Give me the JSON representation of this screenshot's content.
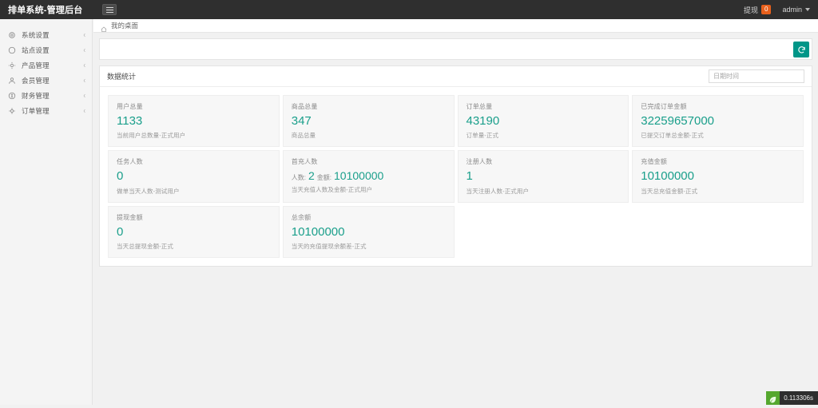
{
  "header": {
    "title": "排单系统-管理后台",
    "menu_toggle_icon": "hamburger-icon",
    "withdraw_label": "提现",
    "withdraw_count": "0",
    "admin_label": "admin"
  },
  "sidebar": {
    "items": [
      {
        "label": "系统设置",
        "icon": "gear-icon",
        "arrow": "‹"
      },
      {
        "label": "站点设置",
        "icon": "globe-icon",
        "arrow": "‹"
      },
      {
        "label": "产品管理",
        "icon": "cube-icon",
        "arrow": "‹"
      },
      {
        "label": "会员管理",
        "icon": "user-icon",
        "arrow": "‹"
      },
      {
        "label": "财务管理",
        "icon": "money-icon",
        "arrow": "‹"
      },
      {
        "label": "订单管理",
        "icon": "cart-icon",
        "arrow": "‹"
      }
    ]
  },
  "breadcrumb": {
    "home_icon": "home-icon",
    "current": "我的桌面"
  },
  "toolbar": {
    "refresh_icon": "refresh-icon"
  },
  "panel": {
    "title": "数据统计",
    "date_placeholder": "日期时间",
    "date_value": ""
  },
  "stats": [
    {
      "label": "用户总量",
      "value": "1133",
      "desc": "当前用户总数量-正式用户",
      "compound": false
    },
    {
      "label": "商品总量",
      "value": "347",
      "desc": "商品总量",
      "compound": false
    },
    {
      "label": "订单总量",
      "value": "43190",
      "desc": "订单量-正式",
      "compound": false
    },
    {
      "label": "已完成订单金额",
      "value": "32259657000",
      "desc": "已提交订单总金额-正式",
      "compound": false
    },
    {
      "label": "任务人数",
      "value": "0",
      "desc": "做单当天人数-测试用户",
      "compound": false
    },
    {
      "label": "首充人数",
      "value": "",
      "desc": "当天充值人数及金额-正式用户",
      "compound": true,
      "people_prefix": "人数:",
      "people_value": "2",
      "amount_prefix": "金额:",
      "amount_value": "10100000"
    },
    {
      "label": "注册人数",
      "value": "1",
      "desc": "当天注册人数-正式用户",
      "compound": false
    },
    {
      "label": "充值金额",
      "value": "10100000",
      "desc": "当天总充值金额-正式",
      "compound": false
    },
    {
      "label": "提现金额",
      "value": "0",
      "desc": "当天总提现金额-正式",
      "compound": false
    },
    {
      "label": "总余额",
      "value": "10100000",
      "desc": "当天的充值提现余额差-正式",
      "compound": false
    }
  ],
  "footer": {
    "leaf_icon": "leaf-icon",
    "elapsed": "0.113306s"
  },
  "colors": {
    "accent": "#009688",
    "value_text": "#1a9f8b",
    "badge": "#e8601c",
    "topbar": "#2f2f2f",
    "leaf": "#55a72e"
  }
}
